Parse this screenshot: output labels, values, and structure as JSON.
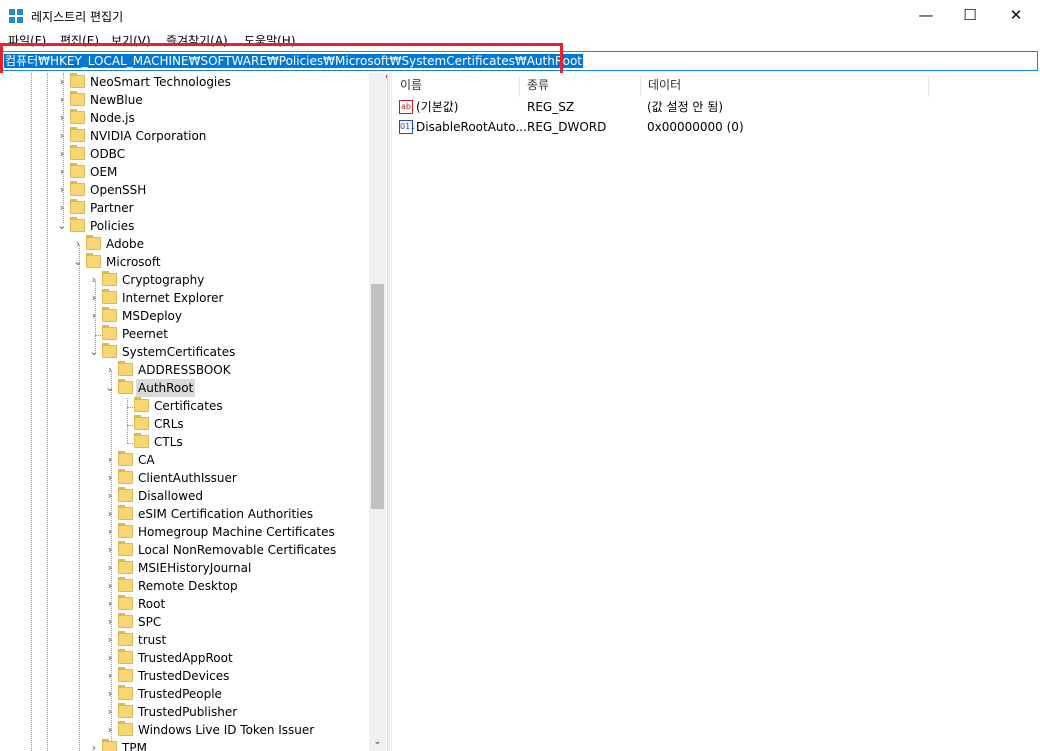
{
  "window": {
    "title": "레지스트리 편집기",
    "minimize": "—",
    "maximize": "☐",
    "close": "✕"
  },
  "menu": [
    "파일(F)",
    "편집(E)",
    "보기(V)",
    "즐겨찾기(A)",
    "도움말(H)"
  ],
  "address": "컴퓨터₩HKEY_LOCAL_MACHINE₩SOFTWARE₩Policies₩Microsoft₩SystemCertificates₩AuthRoot",
  "tree": [
    {
      "label": "NeoSmart Technologies",
      "chevron": "›"
    },
    {
      "label": "NewBlue",
      "chevron": "›"
    },
    {
      "label": "Node.js",
      "chevron": "›"
    },
    {
      "label": "NVIDIA Corporation",
      "chevron": "›"
    },
    {
      "label": "ODBC",
      "chevron": "›"
    },
    {
      "label": "OEM",
      "chevron": "›"
    },
    {
      "label": "OpenSSH",
      "chevron": "›"
    },
    {
      "label": "Partner",
      "chevron": "›"
    },
    {
      "label": "Policies",
      "chevron": "⌄"
    },
    {
      "label": "Adobe",
      "chevron": "›"
    },
    {
      "label": "Microsoft",
      "chevron": "⌄"
    },
    {
      "label": "Cryptography",
      "chevron": "›"
    },
    {
      "label": "Internet Explorer",
      "chevron": "›"
    },
    {
      "label": "MSDeploy",
      "chevron": "›"
    },
    {
      "label": "Peernet",
      "chevron": ""
    },
    {
      "label": "SystemCertificates",
      "chevron": "⌄"
    },
    {
      "label": "ADDRESSBOOK",
      "chevron": "›"
    },
    {
      "label": "AuthRoot",
      "chevron": "⌄"
    },
    {
      "label": "Certificates",
      "chevron": ""
    },
    {
      "label": "CRLs",
      "chevron": ""
    },
    {
      "label": "CTLs",
      "chevron": ""
    },
    {
      "label": "CA",
      "chevron": "›"
    },
    {
      "label": "ClientAuthIssuer",
      "chevron": "›"
    },
    {
      "label": "Disallowed",
      "chevron": "›"
    },
    {
      "label": "eSIM Certification Authorities",
      "chevron": "›"
    },
    {
      "label": "Homegroup Machine Certificates",
      "chevron": "›"
    },
    {
      "label": "Local NonRemovable Certificates",
      "chevron": "›"
    },
    {
      "label": "MSIEHistoryJournal",
      "chevron": "›"
    },
    {
      "label": "Remote Desktop",
      "chevron": "›"
    },
    {
      "label": "Root",
      "chevron": "›"
    },
    {
      "label": "SPC",
      "chevron": "›"
    },
    {
      "label": "trust",
      "chevron": "›"
    },
    {
      "label": "TrustedAppRoot",
      "chevron": "›"
    },
    {
      "label": "TrustedDevices",
      "chevron": "›"
    },
    {
      "label": "TrustedPeople",
      "chevron": "›"
    },
    {
      "label": "TrustedPublisher",
      "chevron": "›"
    },
    {
      "label": "Windows Live ID Token Issuer",
      "chevron": "›"
    },
    {
      "label": "TPM",
      "chevron": "›"
    }
  ],
  "columns": [
    "이름",
    "종류",
    "데이터"
  ],
  "values": [
    {
      "icon": "ab",
      "name": "(기본값)",
      "type": "REG_SZ",
      "data": "(값 설정 안 됨)"
    },
    {
      "icon": "011",
      "name": "DisableRootAuto...",
      "type": "REG_DWORD",
      "data": "0x00000000 (0)"
    }
  ],
  "scroll_down": "⌄",
  "colors": {
    "highlight": "#e8202a",
    "selection": "#0078d7"
  }
}
